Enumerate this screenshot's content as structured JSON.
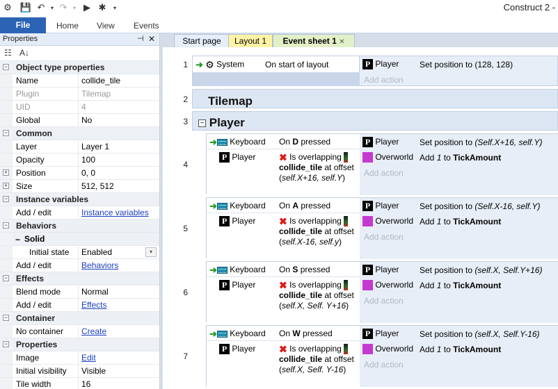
{
  "titlebar": {
    "title": "Construct 2 -"
  },
  "ribbon": {
    "file": "File",
    "tabs": [
      "Home",
      "View",
      "Events"
    ]
  },
  "properties": {
    "header": "Properties",
    "rows": [
      {
        "type": "cat",
        "label": "Object type properties",
        "toggle": "−"
      },
      {
        "type": "row",
        "key": "Name",
        "value": "collide_tile"
      },
      {
        "type": "row",
        "key": "Plugin",
        "value": "Tilemap",
        "disabled": true
      },
      {
        "type": "row",
        "key": "UID",
        "value": "4",
        "disabled": true
      },
      {
        "type": "row",
        "key": "Global",
        "value": "No"
      },
      {
        "type": "cat",
        "label": "Common",
        "toggle": "−"
      },
      {
        "type": "row",
        "key": "Layer",
        "value": "Layer 1"
      },
      {
        "type": "row",
        "key": "Opacity",
        "value": "100"
      },
      {
        "type": "row",
        "key": "Position",
        "value": "0, 0",
        "toggle": "+"
      },
      {
        "type": "row",
        "key": "Size",
        "value": "512, 512",
        "toggle": "+"
      },
      {
        "type": "cat",
        "label": "Instance variables",
        "toggle": "−"
      },
      {
        "type": "row",
        "key": "Add / edit",
        "link": "Instance variables"
      },
      {
        "type": "cat",
        "label": "Behaviors",
        "toggle": "−"
      },
      {
        "type": "subcat",
        "label": "Solid",
        "toggle": "−"
      },
      {
        "type": "sub",
        "key": "Initial state",
        "value": "Enabled",
        "dropdown": true
      },
      {
        "type": "row",
        "key": "Add / edit",
        "link": "Behaviors"
      },
      {
        "type": "cat",
        "label": "Effects",
        "toggle": "−"
      },
      {
        "type": "row",
        "key": "Blend mode",
        "value": "Normal"
      },
      {
        "type": "row",
        "key": "Add / edit",
        "link": "Effects"
      },
      {
        "type": "cat",
        "label": "Container",
        "toggle": "−"
      },
      {
        "type": "row",
        "key": "No container",
        "link": "Create"
      },
      {
        "type": "cat",
        "label": "Properties",
        "toggle": "−"
      },
      {
        "type": "row",
        "key": "Image",
        "link": "Edit"
      },
      {
        "type": "row",
        "key": "Initial visibility",
        "value": "Visible"
      },
      {
        "type": "row",
        "key": "Tile width",
        "value": "16"
      }
    ]
  },
  "doctabs": [
    {
      "label": "Start page",
      "active": false
    },
    {
      "label": "Layout 1",
      "active": false
    },
    {
      "label": "Event sheet 1",
      "active": true
    }
  ],
  "colors": {
    "accent": "#2b64b5",
    "overworld": "#c43ad0",
    "layoutTab": "#fff3a6",
    "eventTab": "#e2f0c8"
  },
  "events": {
    "e1": {
      "num": "1",
      "cond_obj": "System",
      "cond_text": "On start of layout",
      "act_obj": "Player",
      "act_text": "Set position to (128, 128)",
      "add_action": "Add action"
    },
    "g2": {
      "num": "2",
      "title": "Tilemap"
    },
    "g3": {
      "num": "3",
      "title": "Player"
    },
    "e4": {
      "num": "4",
      "key": "D",
      "pos": "(Self.X+16, self.Y)",
      "off": "self.X+16, self.Y"
    },
    "e5": {
      "num": "5",
      "key": "A",
      "pos": "(Self.X-16, self.Y)",
      "off": "self.X-16, self.y"
    },
    "e6": {
      "num": "6",
      "key": "S",
      "pos": "(self.X, Self.Y+16)",
      "off": "self.X, Self. Y+16"
    },
    "e7": {
      "num": "7",
      "key": "W",
      "pos": "(self.X, Self.Y-16)",
      "off": "self.X, Self. Y-16"
    }
  },
  "labels": {
    "keyboard": "Keyboard",
    "on": "On",
    "pressed": "pressed",
    "player": "Player",
    "is_overlapping": "Is overlapping",
    "collide_tile": "collide_tile",
    "at": "at",
    "offset": "offset",
    "set_position": "Set position to",
    "overworld": "Overworld",
    "add": "Add",
    "one": "1",
    "to": "to",
    "tick": "TickAmount",
    "add_action": "Add action"
  }
}
